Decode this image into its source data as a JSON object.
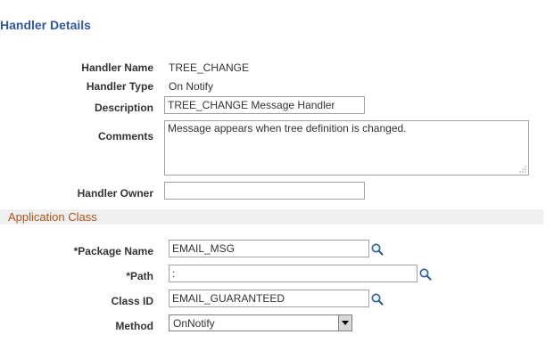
{
  "page": {
    "title": "Handler Details"
  },
  "handler": {
    "name_label": "Handler Name",
    "name_value": "TREE_CHANGE",
    "type_label": "Handler Type",
    "type_value": "On Notify",
    "description_label": "Description",
    "description_value": "TREE_CHANGE Message Handler",
    "comments_label": "Comments",
    "comments_value": "Message appears when tree definition is changed.",
    "owner_label": "Handler Owner",
    "owner_value": ""
  },
  "app_class": {
    "section_title": "Application Class",
    "package_label": "*Package Name",
    "package_value": "EMAIL_MSG",
    "path_label": "*Path",
    "path_value": ":",
    "class_id_label": "Class ID",
    "class_id_value": "EMAIL_GUARANTEED",
    "method_label": "Method",
    "method_selected": "OnNotify"
  },
  "icons": {
    "lookup": "magnifier-lookup-icon",
    "dropdown": "chevron-down-icon",
    "grip": "resize-grip-icon"
  },
  "colors": {
    "title": "#30589a",
    "section_title": "#a8551e",
    "section_bg": "#efefef"
  }
}
